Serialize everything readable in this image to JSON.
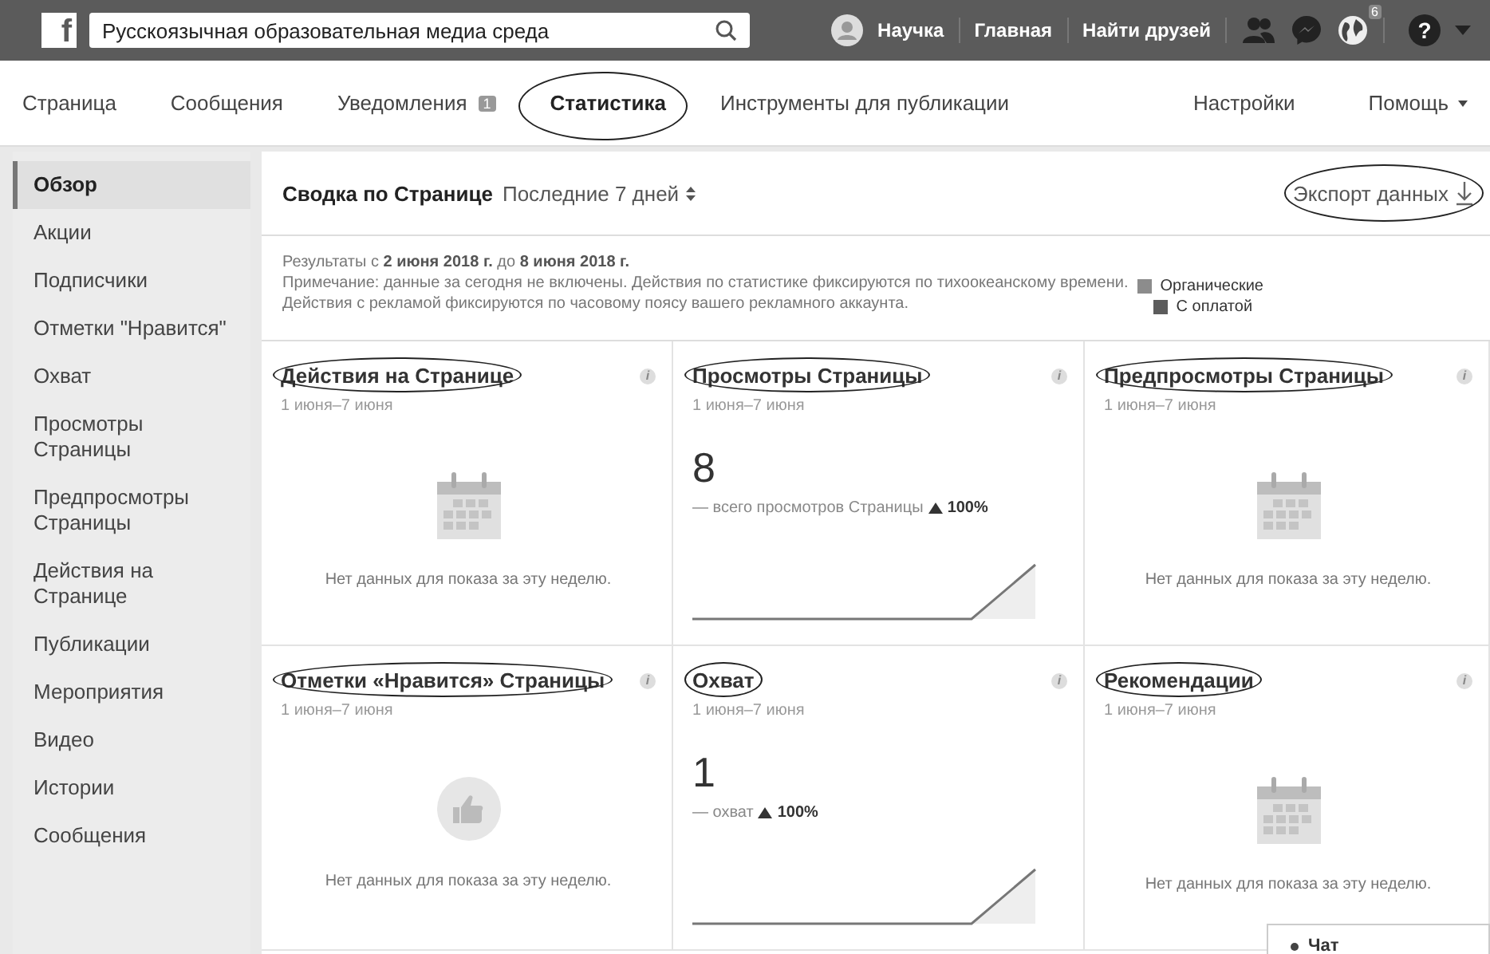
{
  "topbar": {
    "logo": "f",
    "search": {
      "value": "Русскоязычная образовательная медиа среда"
    },
    "profile": "Научка",
    "links": [
      "Главная",
      "Найти друзей"
    ],
    "notifications_badge": "6",
    "help": "?"
  },
  "tabs": [
    {
      "label": "Страница",
      "selected": false,
      "circled": false
    },
    {
      "label": "Сообщения",
      "selected": false,
      "circled": false
    },
    {
      "label": "Уведомления",
      "selected": false,
      "circled": false,
      "badge": "1"
    },
    {
      "label": "Статистика",
      "selected": true,
      "circled": true
    },
    {
      "label": "Инструменты для публикации",
      "selected": false,
      "circled": false
    }
  ],
  "right_tabs": [
    {
      "label": "Настройки",
      "caret": false
    },
    {
      "label": "Помощь",
      "caret": true
    }
  ],
  "sidebar": {
    "items": [
      {
        "label": "Обзор",
        "selected": true
      },
      {
        "label": "Акции",
        "selected": false
      },
      {
        "label": "Подписчики",
        "selected": false
      },
      {
        "label": "Отметки \"Нравится\"",
        "selected": false
      },
      {
        "label": "Охват",
        "selected": false
      },
      {
        "label": "Просмотры Страницы",
        "selected": false
      },
      {
        "label": "Предпросмотры Страницы",
        "selected": false
      },
      {
        "label": "Действия на Странице",
        "selected": false
      },
      {
        "label": "Публикации",
        "selected": false
      },
      {
        "label": "Мероприятия",
        "selected": false
      },
      {
        "label": "Видео",
        "selected": false
      },
      {
        "label": "Истории",
        "selected": false
      },
      {
        "label": "Сообщения",
        "selected": false
      }
    ]
  },
  "summary": {
    "title": "Сводка по Странице",
    "period": "Последние 7 дней",
    "export": {
      "label": "Экспорт данных",
      "circled": true
    }
  },
  "info": {
    "results": "Результаты с **2 июня 2018 г.** до **8 июня 2018 г.**",
    "note_lines": [
      "Примечание: данные за сегодня не включены. Действия по статистике фиксируются по тихоокеанскому времени.",
      "Действия с рекламой фиксируются по часовому поясу вашего рекламного аккаунта."
    ],
    "legend": [
      {
        "label": "Органические",
        "color": "#8c8c8c"
      },
      {
        "label": "С оплатой",
        "color": "#5c5c5c"
      }
    ]
  },
  "cards": [
    {
      "title": "Действия на Странице",
      "info": "i",
      "circled": true,
      "dates": "1 июня–7 июня",
      "kind": "calendar",
      "empty_text": "Нет данных для показа за эту неделю."
    },
    {
      "title": "Просмотры Страницы",
      "info": "i",
      "circled": true,
      "dates": "1 июня–7 июня",
      "kind": "metric",
      "value": "8",
      "caption": "— всего просмотров Страницы",
      "change": "100%"
    },
    {
      "title": "Предпросмотры Страницы",
      "info": "i",
      "circled": true,
      "dates": "1 июня–7 июня",
      "kind": "calendar",
      "empty_text": "Нет данных для показа за эту неделю."
    },
    {
      "title": "Отметки «Нравится» Страницы",
      "info": "i",
      "circled": true,
      "dates": "1 июня–7 июня",
      "kind": "like",
      "empty_text": "Нет данных для показа за эту неделю."
    },
    {
      "title": "Охват",
      "info": "i",
      "circled": true,
      "dates": "1 июня–7 июня",
      "kind": "metric",
      "value": "1",
      "caption": "— охват",
      "change": "100%"
    },
    {
      "title": "Рекомендации",
      "info": "i",
      "circled": true,
      "dates": "1 июня–7 июня",
      "kind": "calendar",
      "empty_text": "Нет данных для показа за эту неделю."
    }
  ],
  "chat": {
    "label": "Чат"
  }
}
